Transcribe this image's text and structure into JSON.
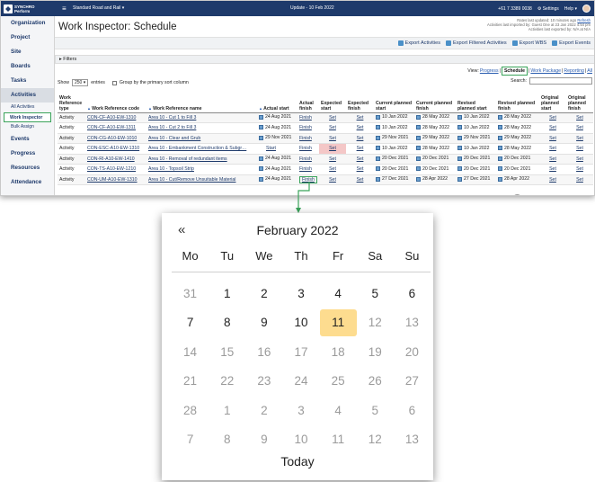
{
  "topbar": {
    "logo_line1": "SYNCHRO",
    "logo_line2": "Perform",
    "project": "Standard Road and Rail",
    "update": "Update - 10 Feb 2022",
    "phone": "+61 7 3389 0038",
    "settings": "Settings",
    "help": "Help"
  },
  "sidebar": {
    "items": [
      {
        "label": "Organization"
      },
      {
        "label": "Project"
      },
      {
        "label": "Site"
      },
      {
        "label": "Boards"
      },
      {
        "label": "Tasks"
      },
      {
        "label": "Activities"
      }
    ],
    "subitems": [
      {
        "label": "All Activities"
      },
      {
        "label": "Work Inspector"
      },
      {
        "label": "Bulk Assign"
      }
    ],
    "items2": [
      {
        "label": "Events"
      },
      {
        "label": "Progress"
      },
      {
        "label": "Resources"
      },
      {
        "label": "Attendance"
      }
    ]
  },
  "rated": {
    "line1": "Rates last updated: 10 minutes ago",
    "refresh": "Refresh",
    "line2": "Activities last imported by: Guest One at 23 Jan 2022 4:54 pm",
    "line3": "Activities last exported by: N/A at N/A"
  },
  "page_title": "Work Inspector: Schedule",
  "exports": [
    "Export Activities",
    "Export Filtered Activities",
    "Export WBS",
    "Export Events"
  ],
  "filters_label": "Filters",
  "view": {
    "prefix": "View:",
    "progress": "Progress",
    "schedule": "Schedule",
    "work_package": "Work Package",
    "reporting": "Reporting",
    "all": "All"
  },
  "show": {
    "prefix": "Show",
    "value": "250",
    "suffix": "entries",
    "group_label": "Group by the primary sort column"
  },
  "search_label": "Search:",
  "columns": [
    "Work Reference type",
    "Work Reference code",
    "Work Reference name",
    "Actual start",
    "Actual finish",
    "Expected start",
    "Expected finish",
    "Current planned start",
    "Current planned finish",
    "Revised planned start",
    "Revised planned finish",
    "Original planned start",
    "Original planned finish"
  ],
  "rows": [
    {
      "type": "Activity",
      "code": "CON-CF-A10-EW-1310",
      "name": "Area 10 - Cut 1 to Fill 3",
      "astart": "24 Aug 2021",
      "afinish": "Finish",
      "estart": "Set",
      "efinish": "Set",
      "cps": "10 Jan 2022",
      "cpf": "28 May 2022",
      "rps": "10 Jan 2022",
      "rpf": "28 May 2022",
      "ops": "Set",
      "opf": "Set"
    },
    {
      "type": "Activity",
      "code": "CON-CF-A10-EW-1311",
      "name": "Area 10 - Cut 2 to Fill 3",
      "astart": "24 Aug 2021",
      "afinish": "Finish",
      "estart": "Set",
      "efinish": "Set",
      "cps": "10 Jan 2022",
      "cpf": "28 May 2022",
      "rps": "10 Jan 2022",
      "rpf": "28 May 2022",
      "ops": "Set",
      "opf": "Set"
    },
    {
      "type": "Activity",
      "code": "CON-CG-A10-EW-1010",
      "name": "Area 10 - Clear and Grub",
      "astart": "29 Nov 2021",
      "afinish": "Finish",
      "estart": "Set",
      "efinish": "Set",
      "cps": "29 Nov 2021",
      "cpf": "29 May 2022",
      "rps": "29 Nov 2021",
      "rpf": "29 May 2022",
      "ops": "Set",
      "opf": "Set"
    },
    {
      "type": "Activity",
      "code": "CON-ESC-A10-EW-1310",
      "name": "Area 10 - Embankment Construction & Subgr…",
      "astart": "Start",
      "afinish": "Finish",
      "estart": "Set",
      "efinish": "Set",
      "cps": "10 Jan 2022",
      "cpf": "28 May 2022",
      "rps": "10 Jan 2022",
      "rpf": "28 May 2022",
      "ops": "Set",
      "opf": "Set"
    },
    {
      "type": "Activity",
      "code": "CON-RI-A10-EW-1410",
      "name": "Area 10 - Removal of redundant items",
      "astart": "24 Aug 2021",
      "afinish": "Finish",
      "estart": "Set",
      "efinish": "Set",
      "cps": "20 Dec 2021",
      "cpf": "20 Dec 2021",
      "rps": "20 Dec 2021",
      "rpf": "20 Dec 2021",
      "ops": "Set",
      "opf": "Set"
    },
    {
      "type": "Activity",
      "code": "CON-TS-A10-EW-1210",
      "name": "Area 10 - Topsoil Strip",
      "astart": "24 Aug 2021",
      "afinish": "Finish",
      "estart": "Set",
      "efinish": "Set",
      "cps": "20 Dec 2021",
      "cpf": "20 Dec 2021",
      "rps": "20 Dec 2021",
      "rpf": "20 Dec 2021",
      "ops": "Set",
      "opf": "Set"
    },
    {
      "type": "Activity",
      "code": "CON-UM-A10-EW-1310",
      "name": "Area 10 - Cut/Remove Unsuitable Material",
      "astart": "24 Aug 2021",
      "afinish": "Finish",
      "estart": "Set",
      "efinish": "Set",
      "cps": "27 Dec 2021",
      "cpf": "28 Apr 2022",
      "rps": "27 Dec 2021",
      "rpf": "28 Apr 2022",
      "ops": "Set",
      "opf": "Set"
    }
  ],
  "bubble": "+",
  "calendar": {
    "prev": "«",
    "title": "February 2022",
    "weekdays": [
      "Mo",
      "Tu",
      "We",
      "Th",
      "Fr",
      "Sa",
      "Su"
    ],
    "days": [
      {
        "d": "31",
        "muted": true
      },
      {
        "d": "1"
      },
      {
        "d": "2"
      },
      {
        "d": "3"
      },
      {
        "d": "4"
      },
      {
        "d": "5"
      },
      {
        "d": "6"
      },
      {
        "d": "7"
      },
      {
        "d": "8"
      },
      {
        "d": "9"
      },
      {
        "d": "10"
      },
      {
        "d": "11",
        "selected": true
      },
      {
        "d": "12",
        "muted": true
      },
      {
        "d": "13",
        "muted": true
      },
      {
        "d": "14",
        "muted": true
      },
      {
        "d": "15",
        "muted": true
      },
      {
        "d": "16",
        "muted": true
      },
      {
        "d": "17",
        "muted": true
      },
      {
        "d": "18",
        "muted": true
      },
      {
        "d": "19",
        "muted": true
      },
      {
        "d": "20",
        "muted": true
      },
      {
        "d": "21",
        "muted": true
      },
      {
        "d": "22",
        "muted": true
      },
      {
        "d": "23",
        "muted": true
      },
      {
        "d": "24",
        "muted": true
      },
      {
        "d": "25",
        "muted": true
      },
      {
        "d": "26",
        "muted": true
      },
      {
        "d": "27",
        "muted": true
      },
      {
        "d": "28",
        "muted": true
      },
      {
        "d": "1",
        "muted": true
      },
      {
        "d": "2",
        "muted": true
      },
      {
        "d": "3",
        "muted": true
      },
      {
        "d": "4",
        "muted": true
      },
      {
        "d": "5",
        "muted": true
      },
      {
        "d": "6",
        "muted": true
      },
      {
        "d": "7",
        "muted": true
      },
      {
        "d": "8",
        "muted": true
      },
      {
        "d": "9",
        "muted": true
      },
      {
        "d": "10",
        "muted": true
      },
      {
        "d": "11",
        "muted": true
      },
      {
        "d": "12",
        "muted": true
      },
      {
        "d": "13",
        "muted": true
      }
    ],
    "today": "Today"
  },
  "colors": {
    "topbar": "#1e3a6b",
    "highlight_green": "#3aa35a",
    "selected_day": "#fddc8f",
    "pink_cell": "#f4c7c7"
  }
}
